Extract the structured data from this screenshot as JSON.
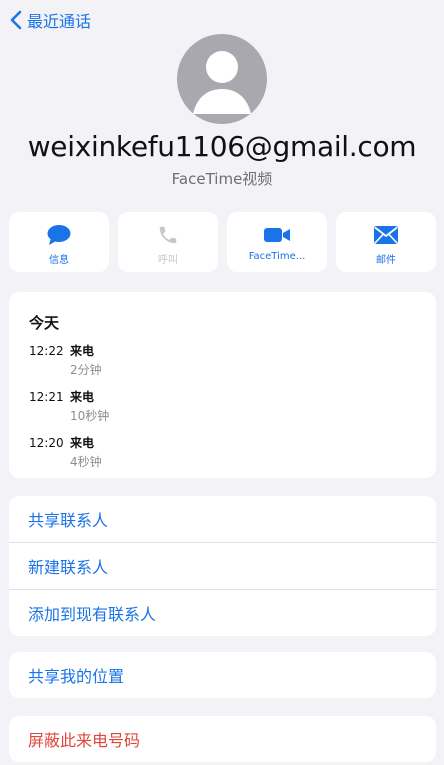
{
  "nav": {
    "back_label": "最近通话",
    "back_icon": "chevron-left-icon"
  },
  "contact": {
    "title": "weixinkefu1106@gmail.com",
    "subtitle": "FaceTime视频",
    "avatar_icon": "person-silhouette-icon"
  },
  "actions": [
    {
      "label": "信息",
      "icon": "message-bubble-icon",
      "enabled": true
    },
    {
      "label": "呼叫",
      "icon": "phone-icon",
      "enabled": false
    },
    {
      "label": "FaceTime...",
      "icon": "video-camera-icon",
      "enabled": true
    },
    {
      "label": "邮件",
      "icon": "envelope-icon",
      "enabled": true
    }
  ],
  "recents": {
    "day": "今天",
    "calls": [
      {
        "time": "12:22",
        "type": "来电",
        "duration": "2分钟"
      },
      {
        "time": "12:21",
        "type": "来电",
        "duration": "10秒钟"
      },
      {
        "time": "12:20",
        "type": "来电",
        "duration": "4秒钟"
      }
    ]
  },
  "contact_actions": [
    {
      "label": "共享联系人"
    },
    {
      "label": "新建联系人"
    },
    {
      "label": "添加到现有联系人"
    }
  ],
  "location": {
    "label": "共享我的位置"
  },
  "block": {
    "label": "屏蔽此来电号码"
  },
  "colors": {
    "accent": "#1a73e8",
    "danger": "#e0463a",
    "background": "#f2f2f7",
    "avatar": "#a8a8ae"
  }
}
